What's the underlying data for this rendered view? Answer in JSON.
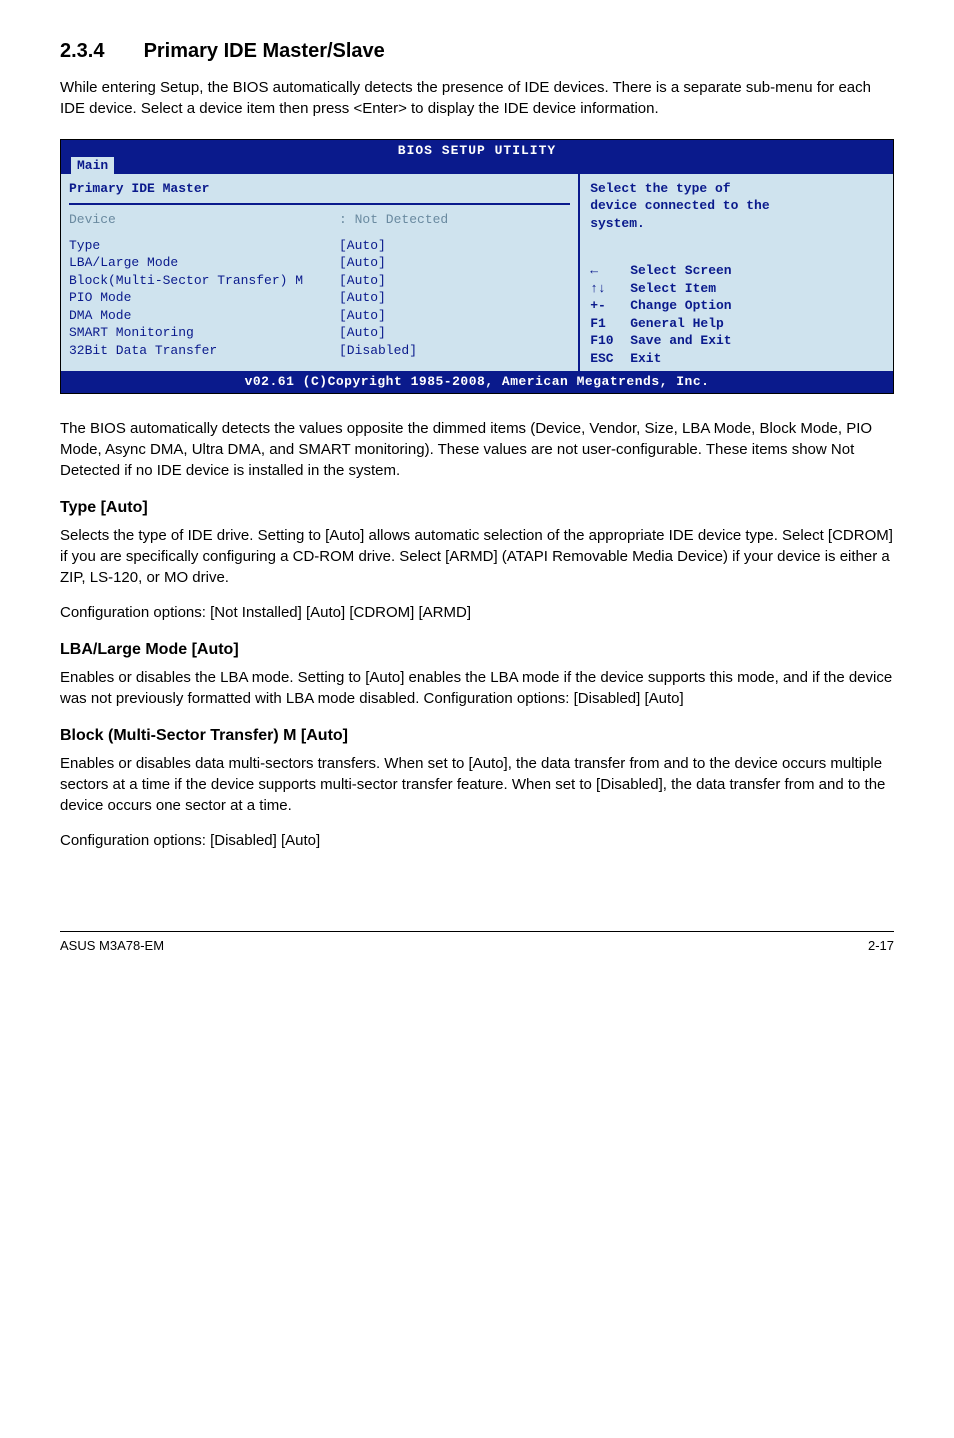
{
  "heading": {
    "number": "2.3.4",
    "title": "Primary IDE Master/Slave"
  },
  "intro": "While entering Setup, the BIOS automatically detects the presence of IDE devices. There is a separate sub-menu for each IDE device. Select a device item then press <Enter> to display the IDE device information.",
  "bios": {
    "title": "BIOS SETUP UTILITY",
    "tab": "Main",
    "panel_title": "Primary IDE Master",
    "device_label": "Device",
    "device_value": ": Not Detected",
    "rows": [
      {
        "label": "Type",
        "value": "[Auto]"
      },
      {
        "label": "LBA/Large Mode",
        "value": "[Auto]"
      },
      {
        "label": "Block(Multi-Sector Transfer) M",
        "value": "[Auto]"
      },
      {
        "label": "PIO Mode",
        "value": "[Auto]"
      },
      {
        "label": "DMA Mode",
        "value": "[Auto]"
      },
      {
        "label": "SMART Monitoring",
        "value": "[Auto]"
      },
      {
        "label": "32Bit Data Transfer",
        "value": "[Disabled]"
      }
    ],
    "help": {
      "line1": "Select the type of",
      "line2": "device connected to the",
      "line3": "system."
    },
    "nav": [
      {
        "key": "←",
        "label": "Select Screen"
      },
      {
        "key": "↑↓",
        "label": "Select Item"
      },
      {
        "key": "+-",
        "label": "Change Option"
      },
      {
        "key": "F1",
        "label": "General Help"
      },
      {
        "key": "F10",
        "label": "Save and Exit"
      },
      {
        "key": "ESC",
        "label": "Exit"
      }
    ],
    "footer": "v02.61 (C)Copyright 1985-2008, American Megatrends, Inc."
  },
  "para_after_bios": "The BIOS automatically detects the values opposite the dimmed items (Device, Vendor, Size, LBA Mode, Block Mode, PIO Mode, Async DMA, Ultra DMA, and SMART monitoring). These values are not user-configurable. These items show Not Detected if no IDE device is installed in the system.",
  "sections": {
    "type": {
      "heading": "Type [Auto]",
      "p1": "Selects the type of IDE drive. Setting to [Auto] allows automatic selection of the appropriate IDE device type. Select [CDROM] if you are specifically configuring a CD-ROM drive. Select [ARMD] (ATAPI Removable Media Device) if your device is either a ZIP, LS-120, or MO drive.",
      "p2": "Configuration options: [Not Installed] [Auto] [CDROM] [ARMD]"
    },
    "lba": {
      "heading": "LBA/Large Mode [Auto]",
      "p1": "Enables or disables the LBA mode. Setting to [Auto] enables the LBA mode if the device supports this mode, and if the device was not previously formatted with LBA mode disabled. Configuration options: [Disabled] [Auto]"
    },
    "block": {
      "heading": "Block (Multi-Sector Transfer) M [Auto]",
      "p1": "Enables or disables data multi-sectors transfers. When set to [Auto], the data transfer from and to the device occurs multiple sectors at a time if the device supports multi-sector transfer feature. When set to [Disabled], the data transfer from and to the device occurs one sector at a time.",
      "p2": "Configuration options: [Disabled] [Auto]"
    }
  },
  "footer": {
    "left": "ASUS M3A78-EM",
    "right": "2-17"
  }
}
